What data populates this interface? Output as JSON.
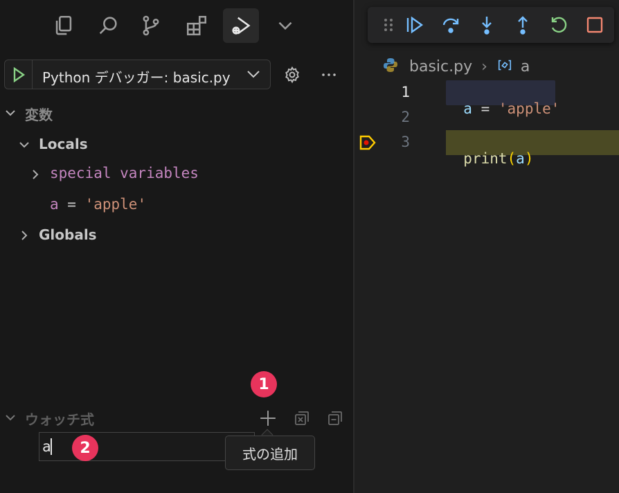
{
  "sidebar": {
    "run_config": {
      "label": "Python デバッガー: basic.py"
    },
    "variables": {
      "title": "変数",
      "locals_label": "Locals",
      "special_label": "special variables",
      "local_var_name": "a",
      "local_var_eq": " = ",
      "local_var_value": "'apple'",
      "globals_label": "Globals"
    },
    "watch": {
      "title": "ウォッチ式",
      "input_value": "a",
      "tooltip": "式の追加"
    },
    "badges": {
      "one": "1",
      "two": "2"
    }
  },
  "editor": {
    "breadcrumb": {
      "file": "basic.py",
      "sep": "›",
      "symbol": "a"
    },
    "lines": {
      "n1": "1",
      "n2": "2",
      "n3": "3",
      "l1_var": "a",
      "l1_op": " = ",
      "l1_str": "'apple'",
      "l3_fn": "print",
      "l3_open": "(",
      "l3_arg": "a",
      "l3_close": ")"
    }
  },
  "colors": {
    "accent_badge": "#e8345c",
    "continue": "#75beff",
    "restart": "#89d185",
    "stop": "#f48771",
    "string": "#ce9178",
    "variable": "#9cdcfe",
    "function": "#dcdcaa",
    "keyword_var": "#c586c0"
  },
  "icons": {
    "activity": [
      "explorer-icon",
      "search-icon",
      "source-control-icon",
      "extensions-icon",
      "run-debug-icon",
      "chevron-down-icon"
    ],
    "debug_toolbar": [
      "drag-handle-icon",
      "continue-icon",
      "step-over-icon",
      "step-into-icon",
      "step-out-icon",
      "restart-icon",
      "stop-icon"
    ]
  }
}
